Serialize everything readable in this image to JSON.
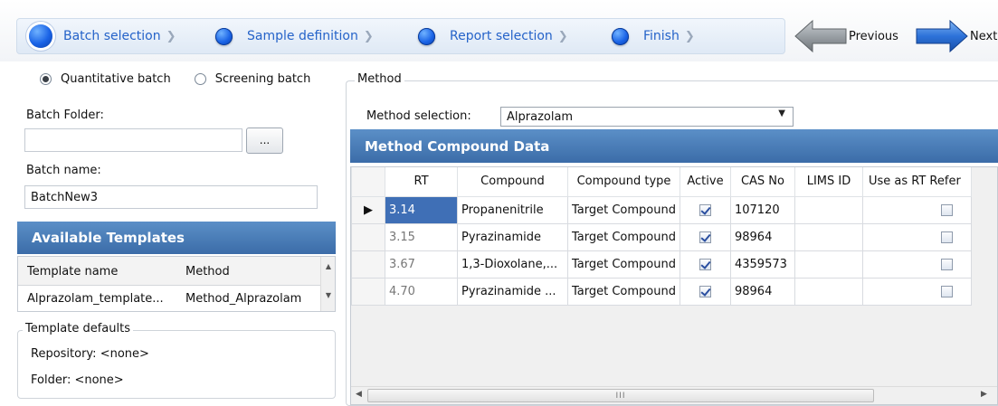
{
  "wizard": {
    "steps": [
      {
        "label": "Batch selection",
        "active": true
      },
      {
        "label": "Sample definition",
        "active": false
      },
      {
        "label": "Report selection",
        "active": false
      },
      {
        "label": "Finish",
        "active": false
      }
    ],
    "chevron": "❯",
    "previous_label": "Previous",
    "next_label": "Next",
    "colors": {
      "step_blue": "#1a63e6",
      "step_text": "#2563c9",
      "arrow_gray": "#8f9599",
      "arrow_blue": "#2d72d9"
    }
  },
  "batch": {
    "type_options": [
      {
        "label": "Quantitative batch",
        "selected": true
      },
      {
        "label": "Screening batch",
        "selected": false
      }
    ],
    "folder_label": "Batch Folder:",
    "folder_value": "",
    "browse_label": "...",
    "name_label": "Batch name:",
    "name_value": "BatchNew3"
  },
  "templates": {
    "header": "Available Templates",
    "columns": [
      "Template name",
      "Method"
    ],
    "rows": [
      [
        "Alprazolam_template...",
        "Method_Alprazolam"
      ]
    ],
    "defaults": {
      "title": "Template defaults",
      "repository": "Repository: <none>",
      "folder": "Folder: <none>"
    }
  },
  "method": {
    "group_title": "Method",
    "selection_label": "Method selection:",
    "selection_value": "Alprazolam",
    "compound_header": "Method Compound Data",
    "columns": [
      "RT",
      "Compound",
      "Compound type",
      "Active",
      "CAS No",
      "LIMS ID",
      "Use as RT Refer"
    ],
    "rows": [
      {
        "rt": "3.14",
        "compound": "Propanenitrile",
        "type": "Target Compound",
        "active": true,
        "cas": "107120",
        "lims": "",
        "rt_ref": false,
        "current": true
      },
      {
        "rt": "3.15",
        "compound": "Pyrazinamide",
        "type": "Target Compound",
        "active": true,
        "cas": "98964",
        "lims": "",
        "rt_ref": false,
        "current": false
      },
      {
        "rt": "3.67",
        "compound": "1,3-Dioxolane,...",
        "type": "Target Compound",
        "active": true,
        "cas": "4359573",
        "lims": "",
        "rt_ref": false,
        "current": false
      },
      {
        "rt": "4.70",
        "compound": "Pyrazinamide ...",
        "type": "Target Compound",
        "active": true,
        "cas": "98964",
        "lims": "",
        "rt_ref": false,
        "current": false
      }
    ],
    "scroll_thumb_glyph": "III"
  }
}
